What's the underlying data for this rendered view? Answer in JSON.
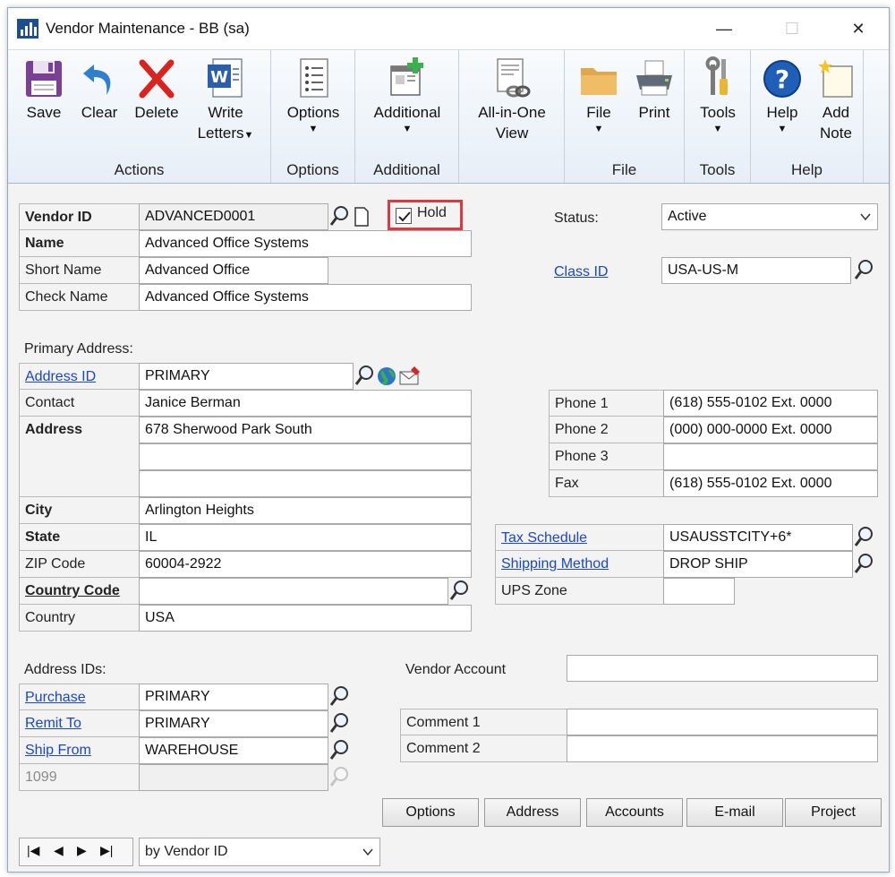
{
  "window": {
    "title": "Vendor Maintenance  -  BB (sa)",
    "minimize": "—",
    "maximize": "☐",
    "close": "✕"
  },
  "ribbon": {
    "groups": [
      {
        "label": "Actions",
        "buttons": [
          "Save",
          "Clear",
          "Delete",
          "Write",
          "Letters"
        ]
      },
      {
        "label": "Options",
        "buttons": [
          "Options"
        ]
      },
      {
        "label": "Additional",
        "buttons": [
          "Additional"
        ]
      },
      {
        "label": "",
        "buttons": [
          "All-in-One",
          "View"
        ]
      },
      {
        "label": "File",
        "buttons": [
          "File",
          "Print"
        ]
      },
      {
        "label": "Tools",
        "buttons": [
          "Tools"
        ]
      },
      {
        "label": "Help",
        "buttons": [
          "Help",
          "Add",
          "Note"
        ]
      }
    ]
  },
  "form": {
    "vendor_id": {
      "label": "Vendor ID",
      "value": "ADVANCED0001"
    },
    "hold": {
      "label": "Hold",
      "checked": true
    },
    "name": {
      "label": "Name",
      "value": "Advanced Office Systems"
    },
    "short_name": {
      "label": "Short Name",
      "value": "Advanced Office"
    },
    "check_name": {
      "label": "Check Name",
      "value": "Advanced Office Systems"
    },
    "status": {
      "label": "Status:",
      "value": "Active"
    },
    "class_id": {
      "label": "Class ID",
      "value": "USA-US-M"
    },
    "primary_address_label": "Primary Address:",
    "address_id": {
      "label": "Address ID",
      "value": "PRIMARY"
    },
    "contact": {
      "label": "Contact",
      "value": "Janice Berman"
    },
    "address": {
      "label": "Address",
      "line1": "678 Sherwood Park South",
      "line2": "",
      "line3": ""
    },
    "city": {
      "label": "City",
      "value": "Arlington Heights"
    },
    "state": {
      "label": "State",
      "value": "IL"
    },
    "zip": {
      "label": "ZIP Code",
      "value": "60004-2922"
    },
    "country_code": {
      "label": "Country Code",
      "value": ""
    },
    "country": {
      "label": "Country",
      "value": "USA"
    },
    "phone1": {
      "label": "Phone 1",
      "value": "(618) 555-0102  Ext. 0000"
    },
    "phone2": {
      "label": "Phone 2",
      "value": "(000) 000-0000  Ext. 0000"
    },
    "phone3": {
      "label": "Phone 3",
      "value": ""
    },
    "fax": {
      "label": "Fax",
      "value": "(618) 555-0102  Ext. 0000"
    },
    "tax_schedule": {
      "label": "Tax Schedule",
      "value": "USAUSSTCITY+6*"
    },
    "shipping_method": {
      "label": "Shipping Method",
      "value": "DROP SHIP"
    },
    "ups_zone": {
      "label": "UPS Zone",
      "value": ""
    },
    "address_ids_label": "Address IDs:",
    "purchase": {
      "label": "Purchase",
      "value": "PRIMARY"
    },
    "remit_to": {
      "label": "Remit To",
      "value": "PRIMARY"
    },
    "ship_from": {
      "label": "Ship From",
      "value": "WAREHOUSE"
    },
    "f1099": {
      "label": "1099",
      "value": ""
    },
    "vendor_account": {
      "label": "Vendor Account",
      "value": ""
    },
    "comment1": {
      "label": "Comment 1",
      "value": ""
    },
    "comment2": {
      "label": "Comment 2",
      "value": ""
    }
  },
  "buttons": {
    "options": "Options",
    "address": "Address",
    "accounts": "Accounts",
    "email": "E-mail",
    "project": "Project"
  },
  "navigation": {
    "first": "|◀",
    "prev": "◀",
    "next": "▶",
    "last": "▶|",
    "sort_by": "by Vendor ID"
  },
  "colors": {
    "link": "#1a46c8",
    "highlight_box": "#e0383e",
    "ribbon_top": "#f9fbfd",
    "ribbon_bottom": "#e6eef7"
  }
}
